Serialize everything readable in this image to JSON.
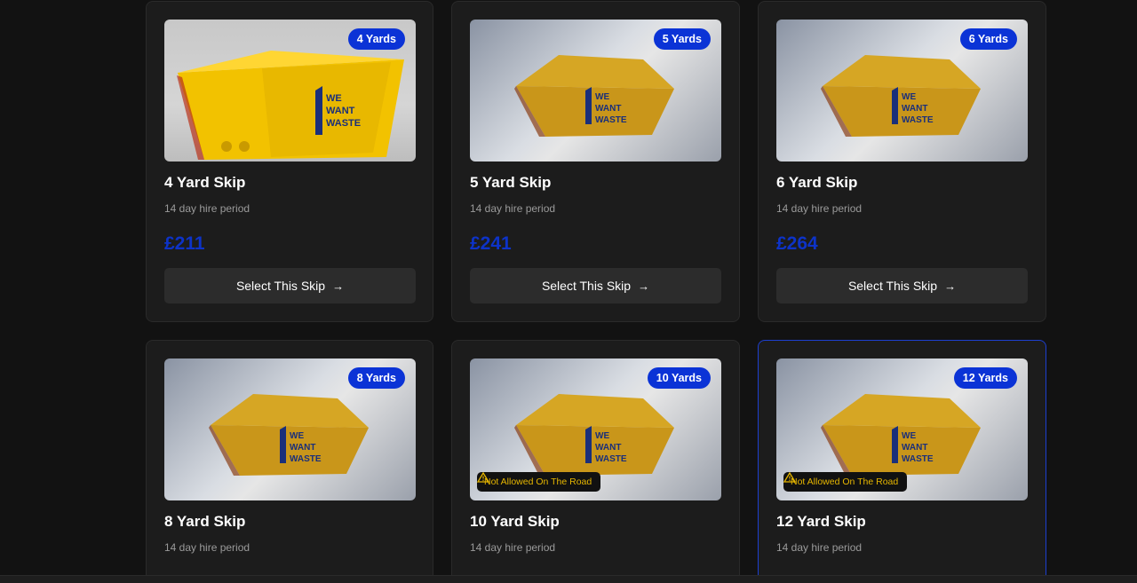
{
  "skips": [
    {
      "badge": "4 Yards",
      "title": "4 Yard Skip",
      "hire": "14 day hire period",
      "price": "£211",
      "button": "Select This Skip",
      "warning": null,
      "selected": false
    },
    {
      "badge": "5 Yards",
      "title": "5 Yard Skip",
      "hire": "14 day hire period",
      "price": "£241",
      "button": "Select This Skip",
      "warning": null,
      "selected": false
    },
    {
      "badge": "6 Yards",
      "title": "6 Yard Skip",
      "hire": "14 day hire period",
      "price": "£264",
      "button": "Select This Skip",
      "warning": null,
      "selected": false
    },
    {
      "badge": "8 Yards",
      "title": "8 Yard Skip",
      "hire": "14 day hire period",
      "warning": null,
      "selected": false
    },
    {
      "badge": "10 Yards",
      "title": "10 Yard Skip",
      "hire": "14 day hire period",
      "warning": "Not Allowed On The Road",
      "selected": false
    },
    {
      "badge": "12 Yards",
      "title": "12 Yard Skip",
      "hire": "14 day hire period",
      "warning": "Not Allowed On The Road",
      "selected": true
    }
  ],
  "logo_text": [
    "WE",
    "WANT",
    "WASTE"
  ],
  "colors": {
    "accent": "#0b33d6",
    "price": "#0d33c8",
    "warning": "#e6b600",
    "background": "#121212",
    "card": "#1c1c1c"
  }
}
